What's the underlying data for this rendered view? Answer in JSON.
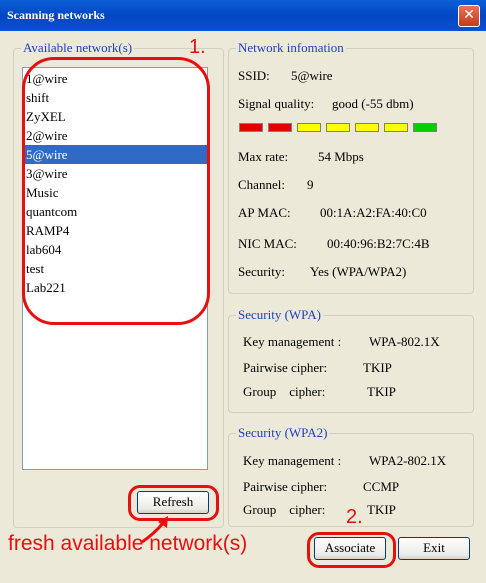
{
  "window": {
    "title": "Scanning networks",
    "close_glyph": "✕"
  },
  "available": {
    "legend": "Available network(s)",
    "networks": [
      "1@wire",
      "shift",
      "ZyXEL",
      "2@wire",
      "5@wire",
      "3@wire",
      "Music",
      "quantcom",
      "RAMP4",
      "lab604",
      "test",
      "Lab221"
    ],
    "selected": "5@wire",
    "refresh_label": "Refresh"
  },
  "info": {
    "legend": "Network infomation",
    "ssid_label": "SSID:",
    "ssid": "5@wire",
    "signal_label": "Signal quality:",
    "signal": "good (-55 dbm)",
    "signal_bars": [
      "#e00000",
      "#e00000",
      "#ffff00",
      "#ffff00",
      "#ffff00",
      "#ffff00",
      "#00d000"
    ],
    "maxrate_label": "Max rate:",
    "maxrate": "54 Mbps",
    "channel_label": "Channel:",
    "channel": "9",
    "apmac_label": "AP MAC:",
    "apmac": "00:1A:A2:FA:40:C0",
    "nicmac_label": "NIC MAC:",
    "nicmac": "00:40:96:B2:7C:4B",
    "security_label": "Security:",
    "security": "Yes (WPA/WPA2)"
  },
  "wpa": {
    "legend": "Security (WPA)",
    "key_label": "Key management :",
    "key": "WPA-802.1X",
    "pair_label": "Pairwise cipher:",
    "pair": "TKIP",
    "group_label": "Group    cipher:",
    "group": "TKIP"
  },
  "wpa2": {
    "legend": "Security (WPA2)",
    "key_label": "Key management :",
    "key": "WPA2-802.1X",
    "pair_label": "Pairwise cipher:",
    "pair": "CCMP",
    "group_label": "Group    cipher:",
    "group": "TKIP"
  },
  "buttons": {
    "associate": "Associate",
    "exit": "Exit"
  },
  "annotations": {
    "step1": "1.",
    "step2": "2.",
    "caption": "fresh available network(s)",
    "color": "#e51010"
  }
}
